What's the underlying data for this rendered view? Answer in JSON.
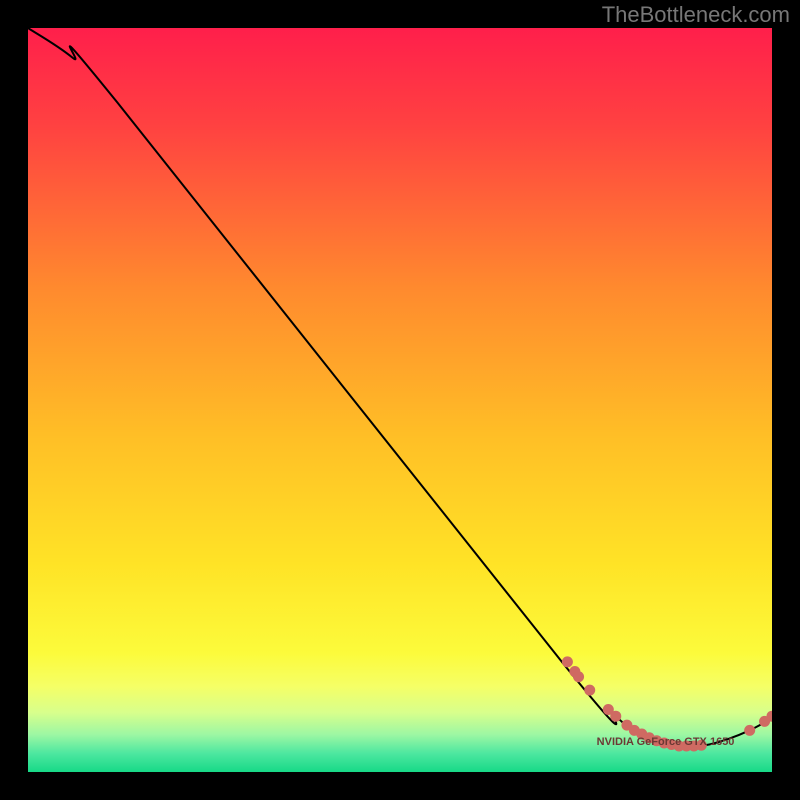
{
  "watermark": "TheBottleneck.com",
  "chart_data": {
    "type": "line",
    "title": "",
    "xlabel": "",
    "ylabel": "",
    "xlim": [
      0,
      100
    ],
    "ylim": [
      0,
      100
    ],
    "curve": [
      {
        "x": 0,
        "y": 100
      },
      {
        "x": 6,
        "y": 96
      },
      {
        "x": 12,
        "y": 90
      },
      {
        "x": 72,
        "y": 14.5
      },
      {
        "x": 79,
        "y": 7.5
      },
      {
        "x": 82,
        "y": 5.2
      },
      {
        "x": 85,
        "y": 4.0
      },
      {
        "x": 88,
        "y": 3.5
      },
      {
        "x": 91,
        "y": 3.6
      },
      {
        "x": 94,
        "y": 4.4
      },
      {
        "x": 97,
        "y": 5.6
      },
      {
        "x": 100,
        "y": 7.2
      }
    ],
    "points": [
      {
        "x": 72.5,
        "y": 14.8
      },
      {
        "x": 73.5,
        "y": 13.5
      },
      {
        "x": 74.0,
        "y": 12.8
      },
      {
        "x": 75.5,
        "y": 11.0
      },
      {
        "x": 78.0,
        "y": 8.4
      },
      {
        "x": 79.0,
        "y": 7.5
      },
      {
        "x": 80.5,
        "y": 6.3
      },
      {
        "x": 81.5,
        "y": 5.6
      },
      {
        "x": 82.5,
        "y": 5.1
      },
      {
        "x": 83.5,
        "y": 4.6
      },
      {
        "x": 84.5,
        "y": 4.2
      },
      {
        "x": 85.5,
        "y": 3.9
      },
      {
        "x": 86.5,
        "y": 3.7
      },
      {
        "x": 87.5,
        "y": 3.5
      },
      {
        "x": 88.5,
        "y": 3.5
      },
      {
        "x": 89.5,
        "y": 3.5
      },
      {
        "x": 90.5,
        "y": 3.6
      },
      {
        "x": 97.0,
        "y": 5.6
      },
      {
        "x": 99.0,
        "y": 6.8
      },
      {
        "x": 100.0,
        "y": 7.5
      }
    ],
    "annotation": {
      "x": 84.5,
      "y": 4.2,
      "text": "NVIDIA GeForce GTX 1650"
    },
    "gradient_stops": [
      {
        "offset": 0.0,
        "color": "#ff1f4b"
      },
      {
        "offset": 0.13,
        "color": "#ff4141"
      },
      {
        "offset": 0.35,
        "color": "#ff8a2e"
      },
      {
        "offset": 0.55,
        "color": "#ffbf26"
      },
      {
        "offset": 0.72,
        "color": "#ffe326"
      },
      {
        "offset": 0.84,
        "color": "#fcfb3b"
      },
      {
        "offset": 0.885,
        "color": "#f5ff66"
      },
      {
        "offset": 0.92,
        "color": "#d8ff8c"
      },
      {
        "offset": 0.95,
        "color": "#9cf7a3"
      },
      {
        "offset": 0.975,
        "color": "#4de7a0"
      },
      {
        "offset": 1.0,
        "color": "#17d987"
      }
    ]
  }
}
